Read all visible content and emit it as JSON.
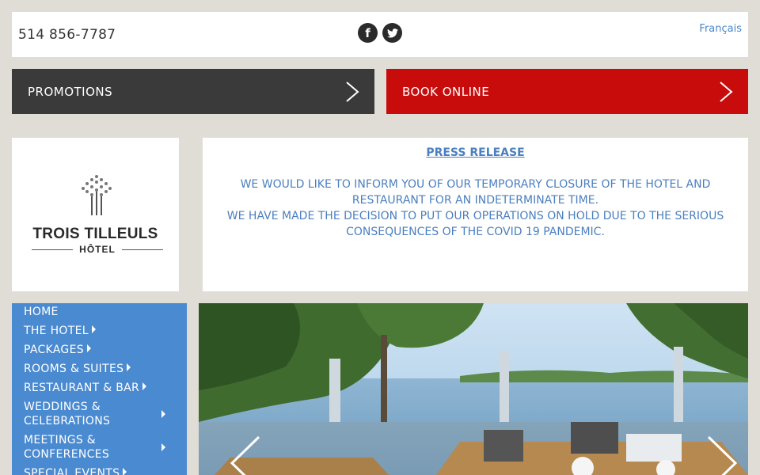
{
  "header": {
    "phone": "514 856-7787",
    "language_link": "Français",
    "social": [
      {
        "name": "facebook",
        "glyph": "f"
      },
      {
        "name": "twitter",
        "glyph": "t"
      }
    ]
  },
  "cta": {
    "promotions": "PROMOTIONS",
    "book_online": "BOOK ONLINE"
  },
  "logo": {
    "name": "TROIS TILLEULS",
    "sub": "HÔTEL"
  },
  "press": {
    "heading": "PRESS RELEASE",
    "line1": "WE WOULD LIKE TO INFORM YOU OF OUR TEMPORARY CLOSURE OF THE HOTEL AND RESTAURANT FOR AN INDETERMINATE TIME.",
    "line2": "WE HAVE MADE THE DECISION TO PUT OUR OPERATIONS ON HOLD DUE TO THE SERIOUS CONSEQUENCES OF THE COVID 19 PANDEMIC."
  },
  "nav": {
    "items": [
      {
        "label": "HOME"
      },
      {
        "label": "THE HOTEL"
      },
      {
        "label": "PACKAGES"
      },
      {
        "label": "ROOMS & SUITES"
      },
      {
        "label": "RESTAURANT & BAR"
      },
      {
        "label": "WEDDINGS & CELEBRATIONS"
      },
      {
        "label": "MEETINGS & CONFERENCES"
      },
      {
        "label": "SPECIAL EVENTS"
      }
    ]
  },
  "colors": {
    "accent_blue": "#4a8ad0",
    "book_red": "#c80c0c",
    "promo_dark": "#3a3a3a"
  }
}
